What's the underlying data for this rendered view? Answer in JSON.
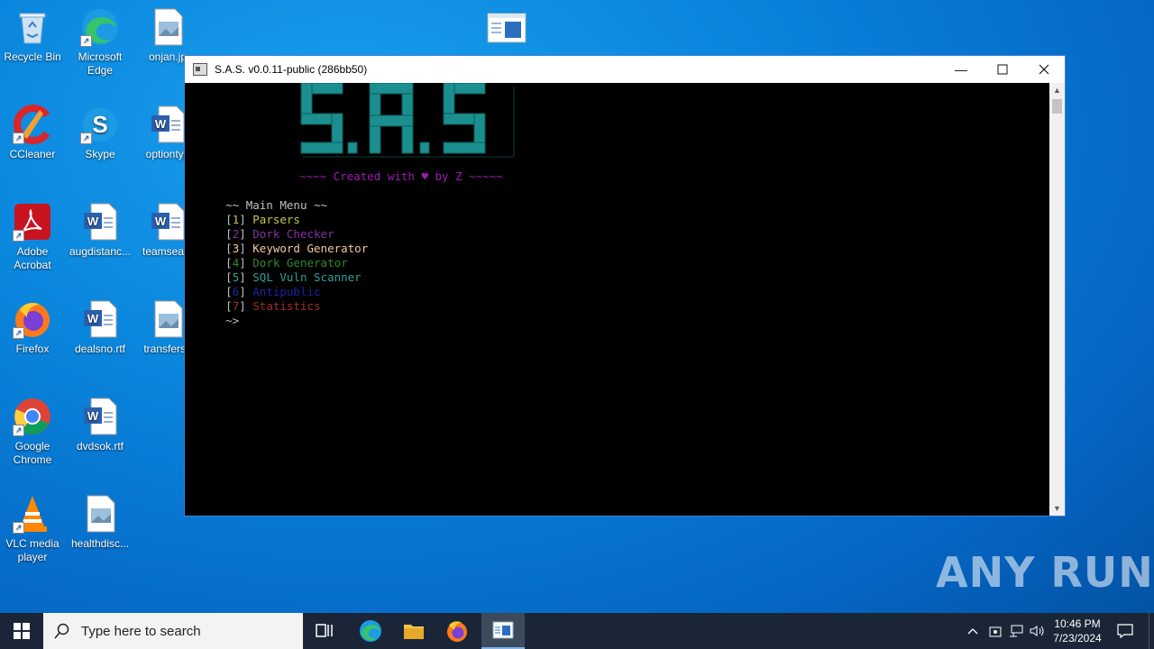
{
  "desktop": {
    "icons": [
      {
        "label": "Recycle Bin"
      },
      {
        "label": "Microsoft Edge"
      },
      {
        "label": "onjan.jp"
      },
      {
        "label": "CCleaner"
      },
      {
        "label": "Skype"
      },
      {
        "label": "optiontyp"
      },
      {
        "label": "Adobe Acrobat"
      },
      {
        "label": "augdistanc..."
      },
      {
        "label": "teamsea..."
      },
      {
        "label": "Firefox"
      },
      {
        "label": "dealsno.rtf"
      },
      {
        "label": "transferso"
      },
      {
        "label": "Google Chrome"
      },
      {
        "label": "dvdsok.rtf"
      },
      {
        "label": "VLC media player"
      },
      {
        "label": "healthdisc..."
      }
    ]
  },
  "window": {
    "title": "S.A.S. v0.0.11-public (286bb50)",
    "credit": "~~~~ Created with ♥ by Z ~~~~~",
    "menu_header": "~~ Main Menu ~~",
    "menu": [
      {
        "num": "1",
        "label": "Parsers",
        "color": "#c8c84a"
      },
      {
        "num": "2",
        "label": "Dork Checker",
        "color": "#8b2fa3"
      },
      {
        "num": "3",
        "label": "Keyword Generator",
        "color": "#f2c8a0"
      },
      {
        "num": "4",
        "label": "Dork Generator",
        "color": "#2e8b2e"
      },
      {
        "num": "5",
        "label": "SQL Vuln Scanner",
        "color": "#2aa198"
      },
      {
        "num": "6",
        "label": "Antipublic",
        "color": "#1a23a8"
      },
      {
        "num": "7",
        "label": "Statistics",
        "color": "#a52a2a"
      }
    ],
    "prompt": "~>"
  },
  "taskbar": {
    "search_placeholder": "Type here to search",
    "time": "10:46 PM",
    "date": "7/23/2024"
  },
  "watermark": "ANY RUN",
  "colors": {
    "accent": "#0a86dd",
    "logo": "#1b8f8f",
    "taskbar": "#1a2637"
  }
}
